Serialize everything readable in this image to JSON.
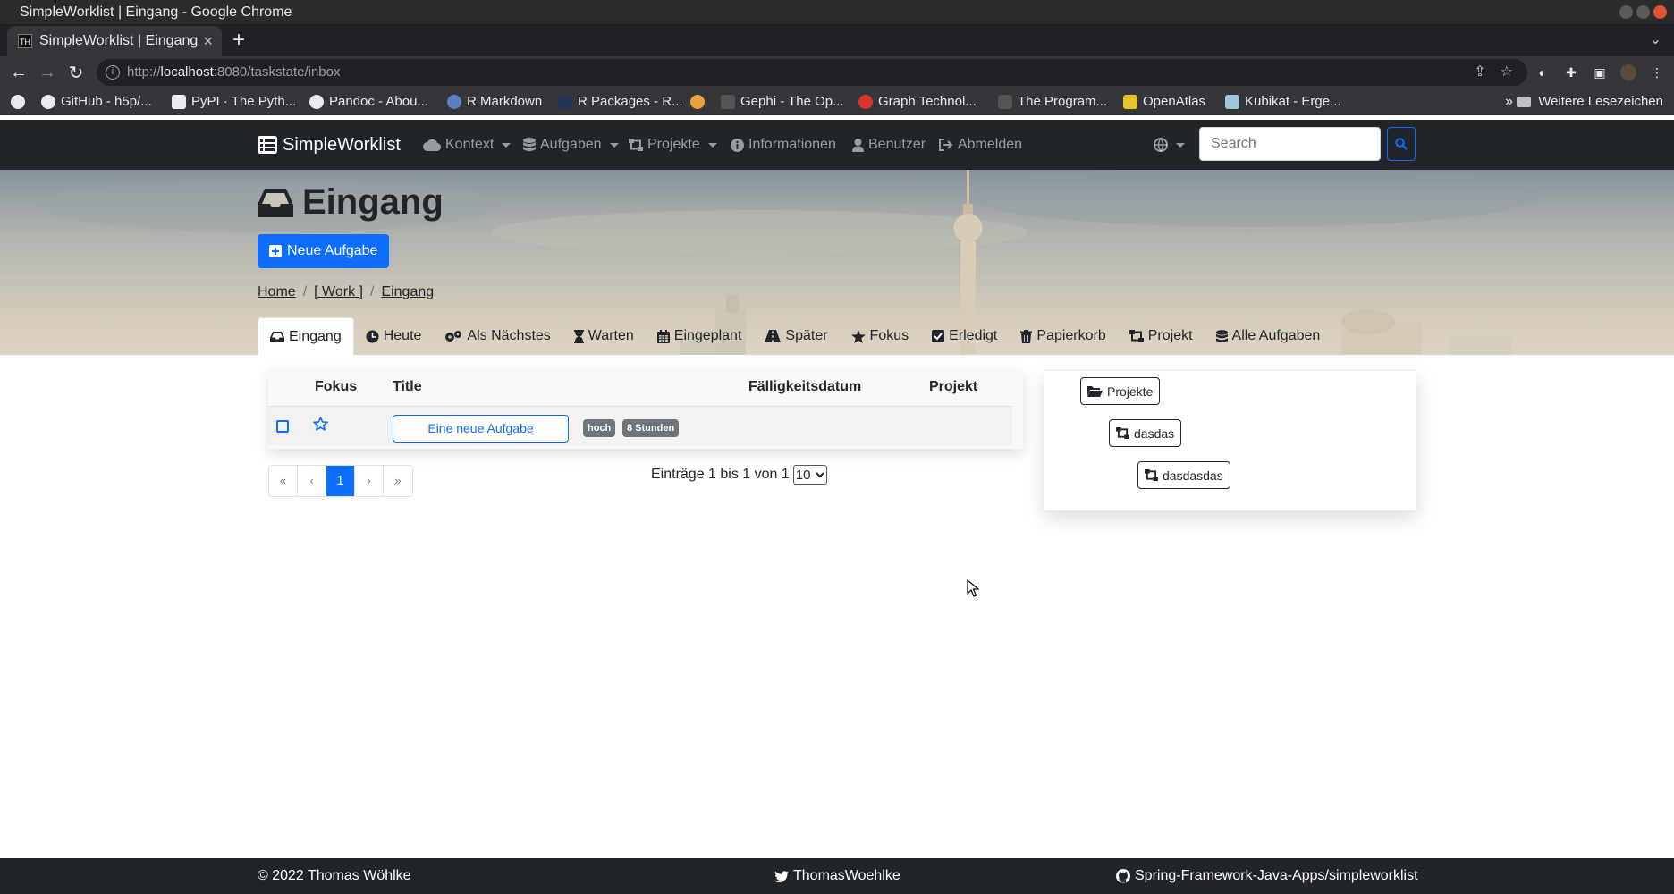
{
  "window": {
    "title": "SimpleWorklist | Eingang - Google Chrome"
  },
  "browser": {
    "tab_title": "SimpleWorklist | Eingang",
    "tab_favicon": "TH",
    "url_scheme": "http://",
    "url_host": "localhost",
    "url_path": ":8080/taskstate/inbox",
    "bookmarks": [
      {
        "label": "GitHub - h5p/...",
        "icon": "github-icon",
        "color": "#e8eaed"
      },
      {
        "label": "PyPI · The Pyth...",
        "icon": "pypi-icon",
        "color": "#e8eaed"
      },
      {
        "label": "Pandoc - Abou...",
        "icon": "globe-icon",
        "color": "#e8eaed"
      },
      {
        "label": "R Markdown",
        "icon": "r-icon",
        "color": "#5a7fc0"
      },
      {
        "label": "R Packages - R...",
        "icon": "book-icon",
        "color": "#223355"
      },
      {
        "label": "",
        "icon": "pinwheel-icon",
        "color": "#e8a13b"
      },
      {
        "label": "Gephi - The Op...",
        "icon": "gephi-icon",
        "color": "#333"
      },
      {
        "label": "Graph Technol...",
        "icon": "neo-icon",
        "color": "#d9342b"
      },
      {
        "label": "The Program...",
        "icon": "program-icon",
        "color": "#444"
      },
      {
        "label": "OpenAtlas",
        "icon": "openatlas-icon",
        "color": "#e3c32e"
      },
      {
        "label": "Kubikat - Erge...",
        "icon": "kubikat-icon",
        "color": "#9ec7d9"
      }
    ],
    "bookmarks_overflow": "»",
    "other_bookmarks": "Weitere Lesezeichen"
  },
  "navbar": {
    "brand": "SimpleWorklist",
    "items": [
      {
        "label": "Kontext",
        "icon": "cloud-icon",
        "dropdown": true
      },
      {
        "label": "Aufgaben",
        "icon": "database-icon",
        "dropdown": true
      },
      {
        "label": "Projekte",
        "icon": "sitemap-icon",
        "dropdown": true
      },
      {
        "label": "Informationen",
        "icon": "info-icon",
        "dropdown": false
      },
      {
        "label": "Benutzer",
        "icon": "user-icon",
        "dropdown": false
      },
      {
        "label": "Abmelden",
        "icon": "sign-out-icon",
        "dropdown": false
      }
    ],
    "search_placeholder": "Search"
  },
  "page": {
    "title": "Eingang",
    "new_task_label": "Neue Aufgabe",
    "breadcrumb": [
      "Home",
      "[ Work ]",
      "Eingang"
    ],
    "tabs": [
      {
        "label": "Eingang",
        "icon": "inbox-icon",
        "active": true
      },
      {
        "label": "Heute",
        "icon": "clock-icon"
      },
      {
        "label": "Als Nächstes",
        "icon": "gears-icon"
      },
      {
        "label": "Warten",
        "icon": "hourglass-icon"
      },
      {
        "label": "Eingeplant",
        "icon": "calendar-icon"
      },
      {
        "label": "Später",
        "icon": "road-icon"
      },
      {
        "label": "Fokus",
        "icon": "star-icon"
      },
      {
        "label": "Erledigt",
        "icon": "check-square-icon"
      },
      {
        "label": "Papierkorb",
        "icon": "trash-icon"
      },
      {
        "label": "Projekt",
        "icon": "sitemap-icon"
      },
      {
        "label": "Alle Aufgaben",
        "icon": "database-icon"
      }
    ]
  },
  "task_table": {
    "headers": {
      "focus": "Fokus",
      "title": "Title",
      "due": "Fälligkeitsdatum",
      "project": "Projekt"
    },
    "rows": [
      {
        "title": "Eine neue Aufgabe",
        "priority": "hoch",
        "effort": "8 Stunden",
        "due": "",
        "project": ""
      }
    ],
    "pagination": {
      "first": "«",
      "prev": "‹",
      "current": "1",
      "next": "›",
      "last": "»"
    },
    "entries_text": "Einträge 1 bis 1 von 1",
    "per_page": "10"
  },
  "project_tree": {
    "root": "Projekte",
    "child": "dasdas",
    "grandchild": "dasdasdas"
  },
  "footer": {
    "copyright": "© 2022 Thomas Wöhlke",
    "twitter": "ThomasWoehlke",
    "github": "Spring-Framework-Java-Apps/simpleworklist"
  },
  "colors": {
    "primary": "#0d6efd",
    "navbar": "#212529",
    "badge": "#6c757d"
  }
}
